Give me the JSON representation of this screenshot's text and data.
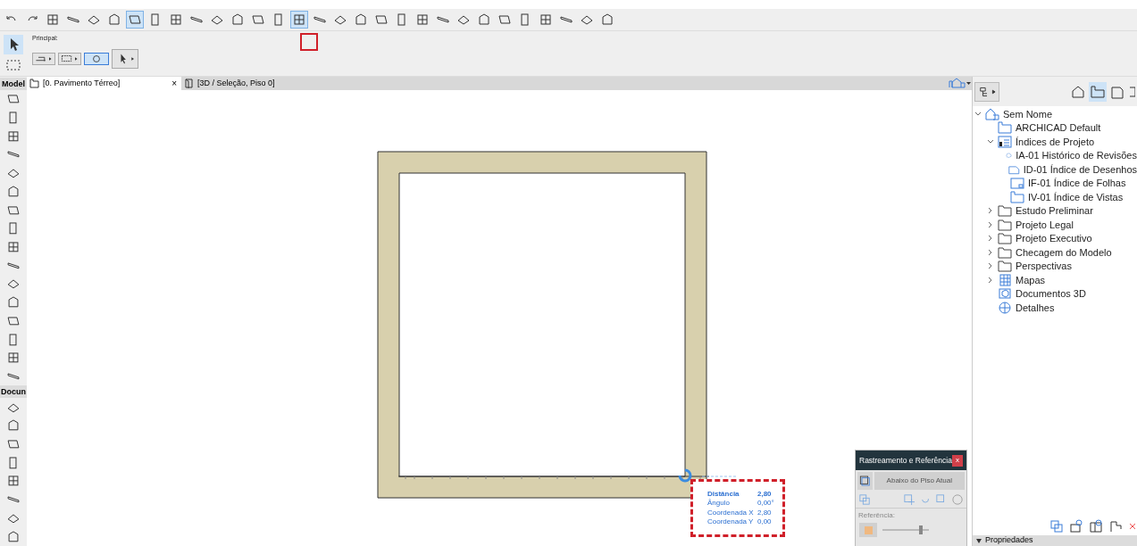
{
  "info_box": {
    "label": "Principal:"
  },
  "tabs": [
    {
      "label": "[0. Pavimento Térreo]",
      "selected": true,
      "close": "×"
    },
    {
      "label": "[3D / Seleção, Piso 0]",
      "selected": false
    }
  ],
  "toolbox": {
    "sections": [
      {
        "label": "Model"
      },
      {
        "label": "Docun"
      }
    ]
  },
  "navigator": {
    "tree": [
      {
        "label": "Sem Nome",
        "kind": "project",
        "expanded": true,
        "children": [
          {
            "label": "ARCHICAD Default",
            "kind": "plan"
          },
          {
            "label": "Índices de Projeto",
            "kind": "index",
            "expanded": true,
            "children": [
              {
                "label": "IA-01 Histórico de Revisões",
                "kind": "revision"
              },
              {
                "label": "ID-01 Índice de Desenhos",
                "kind": "sheet"
              },
              {
                "label": "IF-01 Índice de Folhas",
                "kind": "layout"
              },
              {
                "label": "IV-01 Índice de Vistas",
                "kind": "plan"
              }
            ]
          },
          {
            "label": "Estudo Preliminar",
            "kind": "folder",
            "expanded": false
          },
          {
            "label": "Projeto Legal",
            "kind": "folder",
            "expanded": false
          },
          {
            "label": "Projeto Executivo",
            "kind": "folder",
            "expanded": false
          },
          {
            "label": "Checagem do Modelo",
            "kind": "folder",
            "expanded": false
          },
          {
            "label": "Perspectivas",
            "kind": "folder",
            "expanded": false
          },
          {
            "label": "Mapas",
            "kind": "grid",
            "expanded": false
          },
          {
            "label": "Documentos 3D",
            "kind": "doc3d"
          },
          {
            "label": "Detalhes",
            "kind": "detail"
          }
        ]
      }
    ],
    "properties_header": "Propriedades"
  },
  "tracker": [
    {
      "label": "Distância",
      "value": "2,80",
      "bold": true
    },
    {
      "label": "Ângulo",
      "value": "0,00°",
      "bold": false
    },
    {
      "label": "Coordenada X",
      "value": "2,80",
      "bold": false
    },
    {
      "label": "Coordenada Y",
      "value": "0,00",
      "bold": false
    }
  ],
  "palette": {
    "title": "Rastreamento e Referência",
    "close": "x",
    "dropdown": "Abaixo do Piso Atual",
    "reference_label": "Referência:",
    "slider": {
      "level": 0.85
    }
  }
}
